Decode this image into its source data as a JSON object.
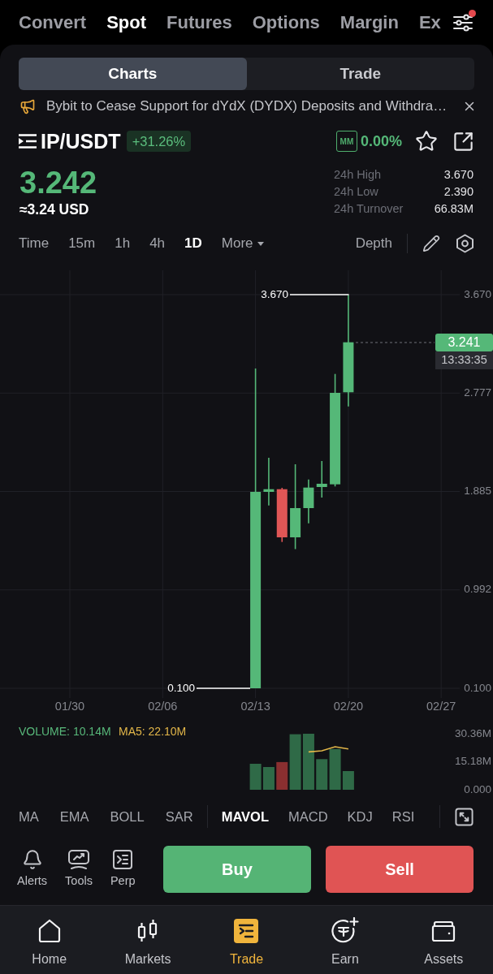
{
  "top_tabs": [
    {
      "label": "Convert",
      "selected": false
    },
    {
      "label": "Spot",
      "selected": true
    },
    {
      "label": "Futures",
      "selected": false
    },
    {
      "label": "Options",
      "selected": false
    },
    {
      "label": "Margin",
      "selected": false
    },
    {
      "label": "Ex",
      "selected": false
    }
  ],
  "settings": {
    "notification": true
  },
  "view_tabs": [
    {
      "label": "Charts",
      "selected": true
    },
    {
      "label": "Trade",
      "selected": false
    }
  ],
  "announcement": {
    "text": "Bybit to Cease Support for dYdX (DYDX) Deposits and Withdra…"
  },
  "pair": {
    "symbol": "IP/USDT",
    "change": "+31.26%",
    "mm_label": "MM",
    "mm_value": "0.00%",
    "favorite": false
  },
  "price": {
    "last": "3.242",
    "fiat": "≈3.24 USD"
  },
  "stats": [
    {
      "label": "24h High",
      "value": "3.670"
    },
    {
      "label": "24h Low",
      "value": "2.390"
    },
    {
      "label": "24h Turnover",
      "value": "66.83M"
    }
  ],
  "intervals": [
    {
      "label": "Time",
      "kind": "option",
      "selected": false
    },
    {
      "label": "15m",
      "kind": "option",
      "selected": false
    },
    {
      "label": "1h",
      "kind": "option",
      "selected": false
    },
    {
      "label": "4h",
      "kind": "option",
      "selected": false
    },
    {
      "label": "1D",
      "kind": "option",
      "selected": true
    },
    {
      "label": "More",
      "kind": "dropdown",
      "selected": false
    }
  ],
  "depth": {
    "label": "Depth"
  },
  "chart": {
    "y_labels": [
      "3.670",
      "2.777",
      "1.885",
      "0.992",
      "0.100"
    ],
    "x_labels": [
      "01/30",
      "02/06",
      "02/13",
      "02/20",
      "02/27"
    ],
    "high_marker": "3.670",
    "low_marker": "0.100",
    "last_price": "3.241",
    "countdown": "13:33:35"
  },
  "volume": {
    "legend": [
      {
        "label": "VOLUME: 10.14M",
        "color": "#58b87a"
      },
      {
        "label": "MA5: 22.10M",
        "color": "#e2b649"
      }
    ],
    "y_labels": [
      "30.36M",
      "15.18M",
      "0.000"
    ]
  },
  "main_indicators": [
    {
      "label": "MA",
      "selected": false
    },
    {
      "label": "EMA",
      "selected": false
    },
    {
      "label": "BOLL",
      "selected": false
    },
    {
      "label": "SAR",
      "selected": false
    }
  ],
  "sub_indicators": [
    {
      "label": "MAVOL",
      "selected": true
    },
    {
      "label": "MACD",
      "selected": false
    },
    {
      "label": "KDJ",
      "selected": false
    },
    {
      "label": "RSI",
      "selected": false
    }
  ],
  "tools": [
    {
      "label": "Alerts"
    },
    {
      "label": "Tools"
    },
    {
      "label": "Perp"
    }
  ],
  "trade_buttons": [
    {
      "label": "Buy",
      "kind": "buy"
    },
    {
      "label": "Sell",
      "kind": "sell"
    }
  ],
  "bottom_nav": [
    {
      "label": "Home",
      "selected": false
    },
    {
      "label": "Markets",
      "selected": false
    },
    {
      "label": "Trade",
      "selected": true
    },
    {
      "label": "Earn",
      "selected": false
    },
    {
      "label": "Assets",
      "selected": false
    }
  ]
}
